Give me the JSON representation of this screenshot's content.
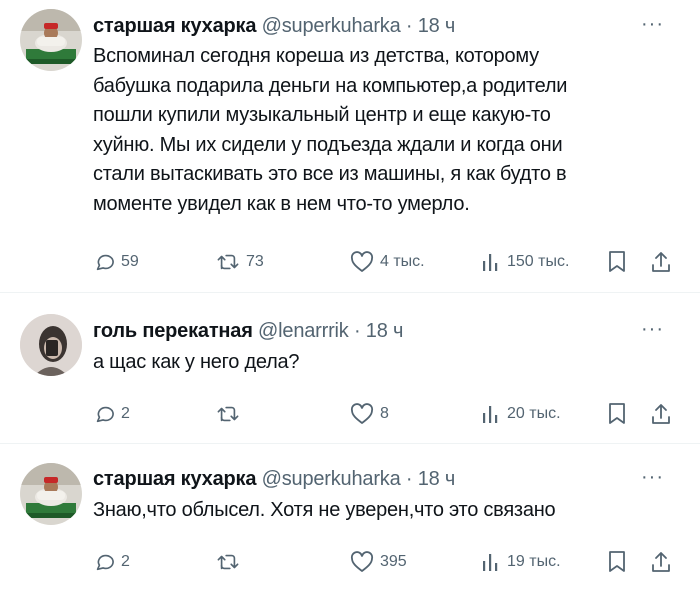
{
  "tweets": [
    {
      "author": "старшая кухарка",
      "handle": "@superkuharka",
      "time": "· 18 ч",
      "more": "···",
      "text": "Вспоминал сегодня кореша из детства, которому\nбабушка подарила деньги на компьютер,а родители\nпошли купили музыкальный центр и еще какую-то\nхуйню. Мы их сидели у подъезда ждали и когда они\nстали вытаскивать это все из машины, я как будто в\nмоменте увидел как в нем что-то умерло.",
      "replies": "59",
      "reposts": "73",
      "likes": "4 тыс.",
      "views": "150 тыс."
    },
    {
      "author": "голь перекатная",
      "handle": "@lenarrrik",
      "time": "· 18 ч",
      "more": "···",
      "text": "а щас как у него дела?",
      "replies": "2",
      "reposts": "",
      "likes": "8",
      "views": "20 тыс."
    },
    {
      "author": "старшая кухарка",
      "handle": "@superkuharka",
      "time": "· 18 ч",
      "more": "···",
      "text": "Знаю,что облысел. Хотя не уверен,что это связано",
      "replies": "2",
      "reposts": "",
      "likes": "395",
      "views": "19 тыс."
    }
  ],
  "colors": {
    "text": "#0f1419",
    "secondary": "#536471",
    "divider": "#eff3f4"
  },
  "icons": [
    "reply-icon",
    "repost-icon",
    "like-icon",
    "views-icon",
    "bookmark-icon",
    "share-icon",
    "more-icon"
  ]
}
